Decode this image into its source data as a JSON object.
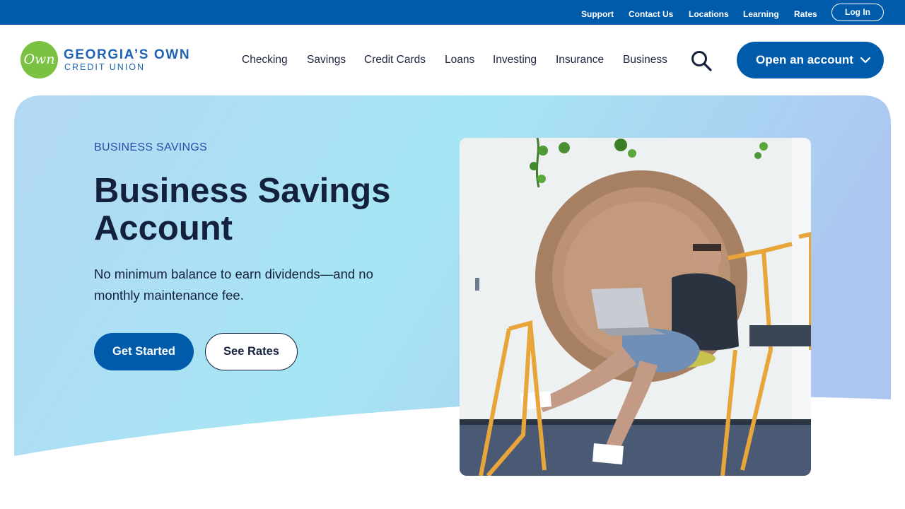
{
  "utility_nav": {
    "items": [
      {
        "label": "Support"
      },
      {
        "label": "Contact Us"
      },
      {
        "label": "Locations"
      },
      {
        "label": "Learning"
      },
      {
        "label": "Rates"
      }
    ],
    "login_label": "Log In"
  },
  "brand": {
    "mark": "Own",
    "name": "GEORGIA’S OWN",
    "subname": "CREDIT UNION"
  },
  "main_nav": {
    "items": [
      {
        "label": "Checking"
      },
      {
        "label": "Savings"
      },
      {
        "label": "Credit Cards"
      },
      {
        "label": "Loans"
      },
      {
        "label": "Investing"
      },
      {
        "label": "Insurance"
      },
      {
        "label": "Business"
      }
    ],
    "search_icon": "search-icon",
    "cta_label": "Open an account",
    "cta_icon": "chevron-down-icon"
  },
  "hero": {
    "eyebrow": "BUSINESS SAVINGS",
    "title": "Business Savings Account",
    "description": "No minimum balance to earn dividends—and no monthly maintenance fee.",
    "primary_button": "Get Started",
    "secondary_button": "See Rates"
  },
  "colors": {
    "brand_blue": "#005baa",
    "logo_green": "#7cc242",
    "eyebrow_blue": "#2a4fa7",
    "heading_navy": "#14213d",
    "hero_gradient_start": "#b3d7f3",
    "hero_gradient_mid": "#a6e6f4",
    "hero_gradient_end": "#adc6f0"
  }
}
